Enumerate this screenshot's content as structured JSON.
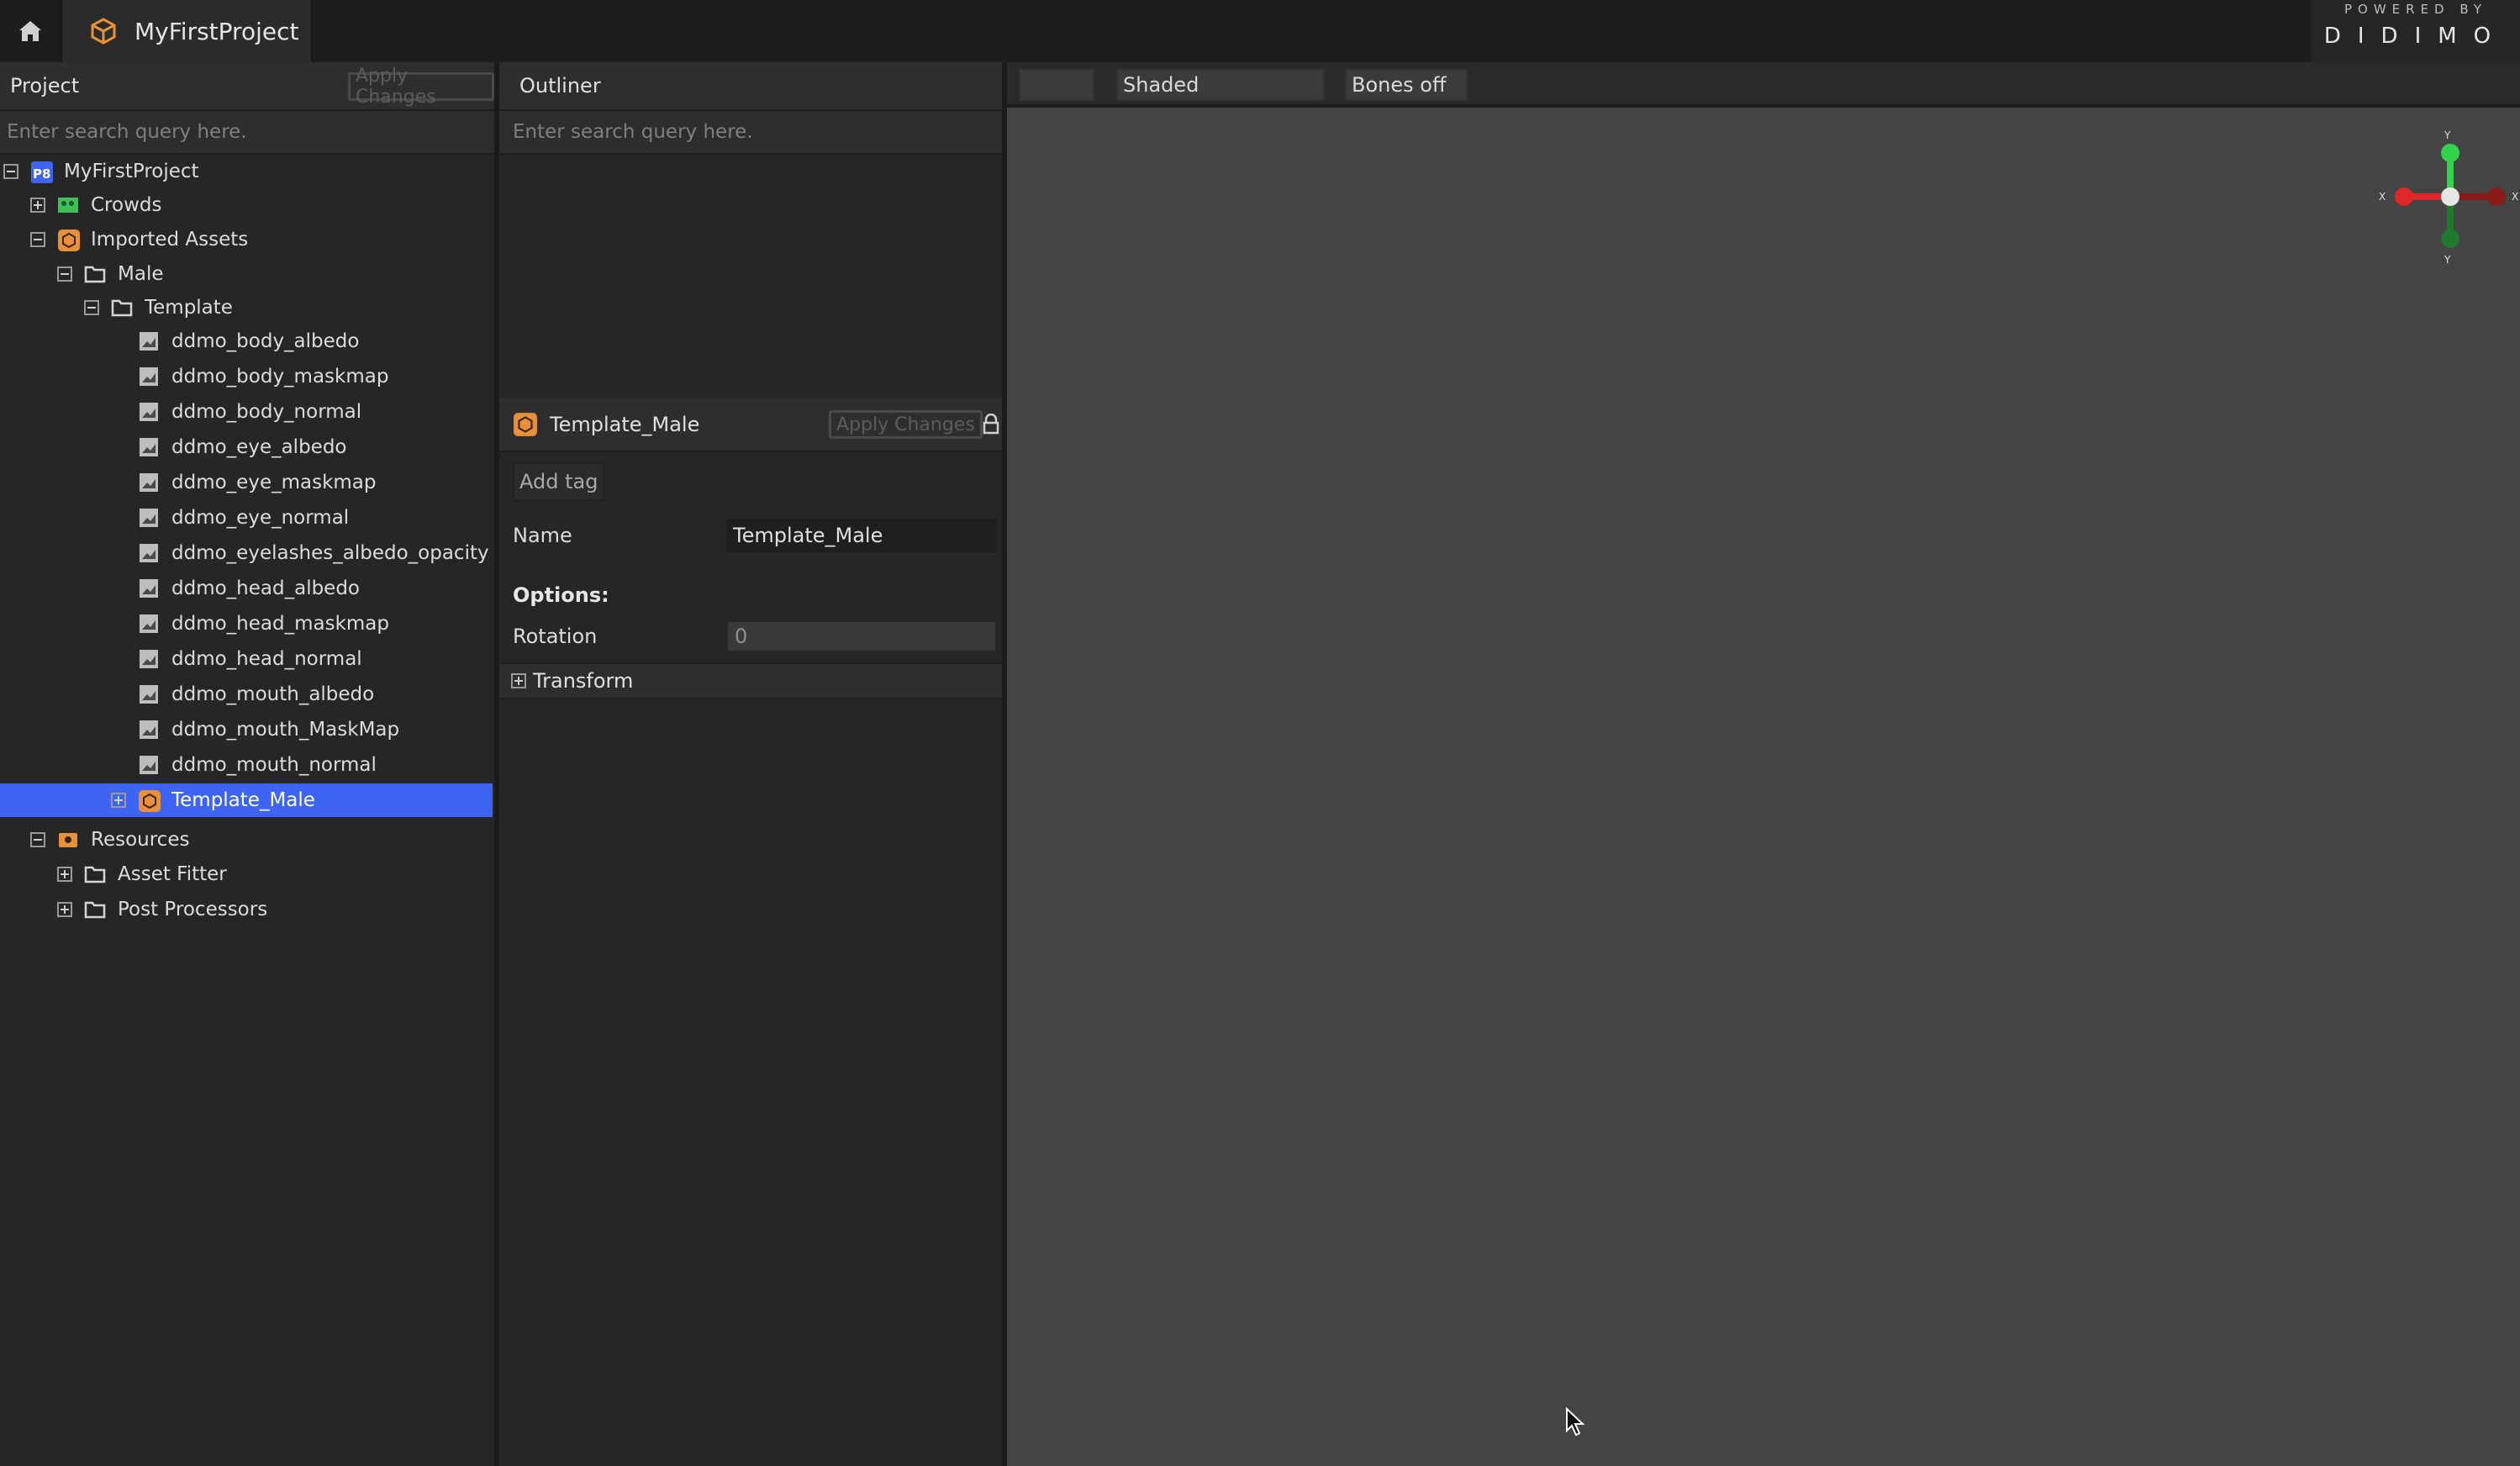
{
  "app": {
    "tab_title": "MyFirstProject",
    "brand_powered": "POWERED BY",
    "brand_name": "DIDIMO",
    "accent_color": "#3d64f2"
  },
  "project_panel": {
    "title": "Project",
    "apply_label": "Apply Changes",
    "search_placeholder": "Enter search query here.",
    "tree": {
      "root": "MyFirstProject",
      "crowds": "Crowds",
      "imported_assets": "Imported Assets",
      "male": "Male",
      "template": "Template",
      "textures": [
        "ddmo_body_albedo",
        "ddmo_body_maskmap",
        "ddmo_body_normal",
        "ddmo_eye_albedo",
        "ddmo_eye_maskmap",
        "ddmo_eye_normal",
        "ddmo_eyelashes_albedo_opacity",
        "ddmo_head_albedo",
        "ddmo_head_maskmap",
        "ddmo_head_normal",
        "ddmo_mouth_albedo",
        "ddmo_mouth_MaskMap",
        "ddmo_mouth_normal"
      ],
      "template_male": "Template_Male",
      "resources": "Resources",
      "asset_fitter": "Asset Fitter",
      "post_processors": "Post Processors"
    }
  },
  "outliner": {
    "title": "Outliner",
    "search_placeholder": "Enter search query here."
  },
  "inspector": {
    "title": "Template_Male",
    "apply_label": "Apply Changes",
    "add_tag_label": "Add tag",
    "name_label": "Name",
    "name_value": "Template_Male",
    "options_heading": "Options:",
    "rotation_label": "Rotation",
    "rotation_value": "0",
    "transform_label": "Transform"
  },
  "viewport": {
    "shading_mode": "Shaded",
    "bones_mode": "Bones off",
    "gizmo_axes": [
      "Y",
      "X",
      "Y",
      "X"
    ]
  }
}
